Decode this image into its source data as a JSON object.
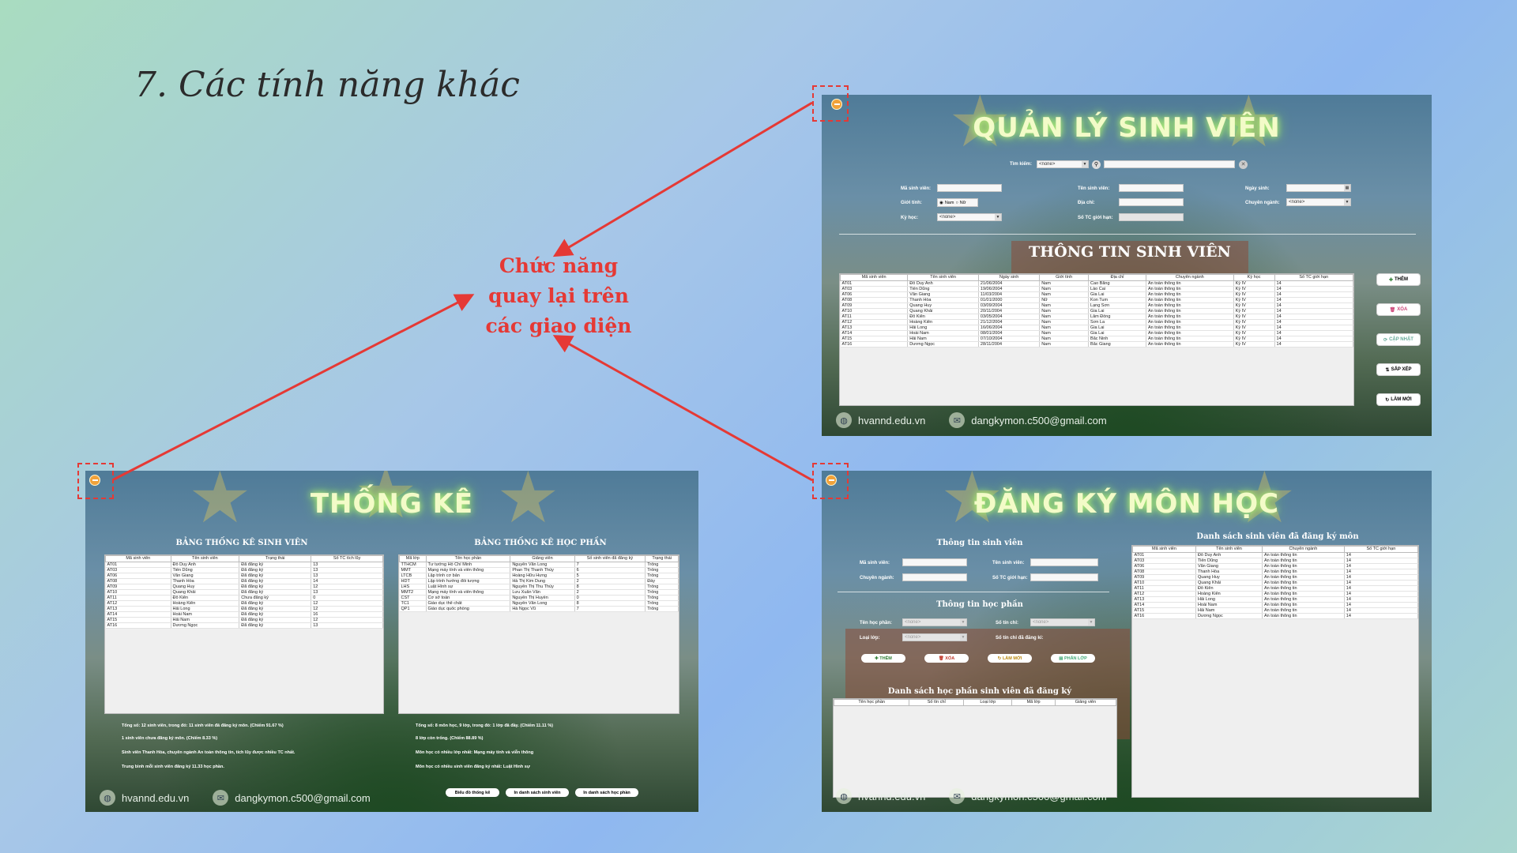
{
  "slide": {
    "title": "7. Các tính năng khác",
    "callout": [
      "Chức năng",
      "quay lại trên",
      "các giao diện"
    ]
  },
  "colors": {
    "callout_red": "#e53935",
    "title_glow": "#b9f57a"
  },
  "footer": {
    "site": "hvannd.edu.vn",
    "email": "dangkymon.c500@gmail.com"
  },
  "icons": {
    "back": "back-icon",
    "globe": "globe-icon",
    "mail": "mail-icon"
  },
  "qlsv": {
    "title": "QUẢN LÝ SINH VIÊN",
    "search_label": "Tìm kiếm:",
    "search_select": "<none>",
    "labels": {
      "ma_sv": "Mã sinh viên:",
      "ten_sv": "Tên sinh viên:",
      "ngay_sinh": "Ngày sinh:",
      "gioi_tinh": "Giới tính:",
      "dia_chi": "Địa chỉ:",
      "chuyen_nganh": "Chuyên ngành:",
      "ky_hoc": "Kỳ học:",
      "so_tc": "Số TC giới hạn:"
    },
    "gender": {
      "male": "Nam",
      "female": "Nữ"
    },
    "chuyen_nganh_value": "<none>",
    "ky_hoc_value": "<none>",
    "section": "THÔNG TIN SINH VIÊN",
    "columns": [
      "Mã sinh viên",
      "Tên sinh viên",
      "Ngày sinh",
      "Giới tính",
      "Địa chỉ",
      "Chuyên ngành",
      "Kỳ học",
      "Số TC giới hạn"
    ],
    "rows": [
      [
        "AT01",
        "Đỗ Duy Anh",
        "21/06/2004",
        "Nam",
        "Cao Bằng",
        "An toàn thông tin",
        "Kỳ IV",
        "14"
      ],
      [
        "AT03",
        "Tiến Dũng",
        "19/06/2004",
        "Nam",
        "Lào Cai",
        "An toàn thông tin",
        "Kỳ IV",
        "14"
      ],
      [
        "AT06",
        "Văn Giang",
        "11/03/2004",
        "Nam",
        "Gia Lai",
        "An toàn thông tin",
        "Kỳ IV",
        "14"
      ],
      [
        "AT08",
        "Thanh Hòa",
        "01/01/2000",
        "Nữ",
        "Kon Tum",
        "An toàn thông tin",
        "Kỳ IV",
        "14"
      ],
      [
        "AT09",
        "Quang Huy",
        "03/09/2004",
        "Nam",
        "Lạng Sơn",
        "An toàn thông tin",
        "Kỳ IV",
        "14"
      ],
      [
        "AT10",
        "Quang Khải",
        "20/11/2004",
        "Nam",
        "Gia Lai",
        "An toàn thông tin",
        "Kỳ IV",
        "14"
      ],
      [
        "AT11",
        "Đỗ Kiên",
        "03/05/2004",
        "Nam",
        "Lâm Đồng",
        "An toàn thông tin",
        "Kỳ IV",
        "14"
      ],
      [
        "AT12",
        "Hoàng Kiên",
        "21/12/2004",
        "Nam",
        "Sơn La",
        "An toàn thông tin",
        "Kỳ IV",
        "14"
      ],
      [
        "AT13",
        "Hải Long",
        "16/06/2004",
        "Nam",
        "Gia Lai",
        "An toàn thông tin",
        "Kỳ IV",
        "14"
      ],
      [
        "AT14",
        "Hoài Nam",
        "08/01/2004",
        "Nam",
        "Gia Lai",
        "An toàn thông tin",
        "Kỳ IV",
        "14"
      ],
      [
        "AT15",
        "Hải Nam",
        "07/10/2004",
        "Nam",
        "Bắc Ninh",
        "An toàn thông tin",
        "Kỳ IV",
        "14"
      ],
      [
        "AT16",
        "Dương Ngọc",
        "28/11/2004",
        "Nam",
        "Bắc Giang",
        "An toàn thông tin",
        "Kỳ IV",
        "14"
      ]
    ],
    "buttons": {
      "them": "THÊM",
      "xoa": "XÓA",
      "cap_nhat": "CẬP NHẬT",
      "sap_xep": "SẮP XẾP",
      "lam_moi": "LÀM MỚI"
    }
  },
  "thongke": {
    "title": "THỐNG KÊ",
    "sv_header": "BẢNG THỐNG KÊ SINH VIÊN",
    "hp_header": "BẢNG THỐNG KÊ HỌC PHẦN",
    "sv_columns": [
      "Mã sinh viên",
      "Tên sinh viên",
      "Trạng thái",
      "Số TC tích lũy"
    ],
    "sv_rows": [
      [
        "AT01",
        "Đỗ Duy Anh",
        "Đã đăng ký",
        "13"
      ],
      [
        "AT03",
        "Tiến Dũng",
        "Đã đăng ký",
        "13"
      ],
      [
        "AT06",
        "Văn Giang",
        "Đã đăng ký",
        "13"
      ],
      [
        "AT08",
        "Thanh Hòa",
        "Đã đăng ký",
        "14"
      ],
      [
        "AT09",
        "Quang Huy",
        "Đã đăng ký",
        "12"
      ],
      [
        "AT10",
        "Quang Khải",
        "Đã đăng ký",
        "13"
      ],
      [
        "AT11",
        "Đỗ Kiên",
        "Chưa đăng ký",
        "0"
      ],
      [
        "AT12",
        "Hoàng Kiên",
        "Đã đăng ký",
        "12"
      ],
      [
        "AT13",
        "Hải Long",
        "Đã đăng ký",
        "12"
      ],
      [
        "AT14",
        "Hoài Nam",
        "Đã đăng ký",
        "16"
      ],
      [
        "AT15",
        "Hải Nam",
        "Đã đăng ký",
        "12"
      ],
      [
        "AT16",
        "Dương Ngọc",
        "Đã đăng ký",
        "13"
      ]
    ],
    "hp_columns": [
      "Mã lớp",
      "Tên học phần",
      "Giảng viên",
      "Số sinh viên đã đăng ký",
      "Trạng thái"
    ],
    "hp_rows": [
      [
        "TTHCM",
        "Tư tưởng Hồ Chí Minh",
        "Nguyễn Văn Long",
        "7",
        "Trống"
      ],
      [
        "MMT",
        "Mạng máy tính và viễn thông",
        "Phan Thị Thanh Thủy",
        "6",
        "Trống"
      ],
      [
        "LTCB",
        "Lập trình cơ bản",
        "Hoàng Hữu Hưng",
        "5",
        "Trống"
      ],
      [
        "HDT",
        "Lập trình hướng đối tượng",
        "Hà Thị Kim Dung",
        "2",
        "Đầy"
      ],
      [
        "LHS",
        "Luật Hình sự",
        "Nguyễn Thị Thu Thủy",
        "8",
        "Trống"
      ],
      [
        "MMT2",
        "Mạng máy tính và viễn thông",
        "Lưu Xuân Văn",
        "2",
        "Trống"
      ],
      [
        "CST",
        "Cơ sở toán",
        "Nguyễn Thị Huyền",
        "0",
        "Trống"
      ],
      [
        "TC1",
        "Giáo dục thể chất",
        "Nguyễn Văn Long",
        "8",
        "Trống"
      ],
      [
        "QP1",
        "Giáo dục quốc phòng",
        "Hà Ngọc Vũ",
        "7",
        "Trống"
      ]
    ],
    "stats_left": [
      "Tổng số: 12 sinh viên, trong đó:          11 sinh viên đã đăng ký môn. (Chiếm 91.67 %)",
      "                                                                  1 sinh viên chưa đăng ký môn. (Chiếm 8.33 %)",
      "Sinh viên Thanh Hòa, chuyên ngành An toàn thông tin, tích lũy được nhiều TC nhất.",
      "Trung bình mỗi sinh viên đăng ký 11.33 học phần."
    ],
    "stats_right": [
      "Tổng số: 8 môn học, 9 lớp, trong đó:          1 lớp đã đầy. (Chiếm 11.11 %)",
      "                                                                   8 lớp còn trống. (Chiếm 88.89 %)",
      "Môn học có nhiều lớp nhất: Mạng máy tính và viễn thông",
      "Môn học có nhiều sinh viên đăng ký nhất: Luật Hình sự"
    ],
    "buttons": {
      "chart": "Biểu đồ thống kê",
      "print_sv": "In danh sách sinh viên",
      "print_hp": "In danh sách học phần"
    }
  },
  "dkmh": {
    "title": "ĐĂNG KÝ MÔN HỌC",
    "sv_section": "Thông tin sinh viên",
    "hp_section": "Thông tin học phần",
    "list_header": "Danh sách sinh viên đã đăng ký môn",
    "reg_header": "Danh sách học phần sinh viên đã đăng ký",
    "labels": {
      "ma_sv": "Mã sinh viên:",
      "ten_sv": "Tên sinh viên:",
      "chuyen_nganh": "Chuyên ngành:",
      "so_tc": "Số TC giới hạn:",
      "ten_hp": "Tên học phần:",
      "so_tin_chi": "Số tín chỉ:",
      "loai_lop": "Loại lớp:",
      "so_tc_da_dk": "Số tín chỉ đã đăng kí:"
    },
    "placeholders": {
      "ten_hp": "<none>",
      "so_tin_chi": "<none>",
      "loai_lop": "<none>"
    },
    "buttons": {
      "them": "THÊM",
      "xoa": "XÓA",
      "lam_moi": "LÀM MỚI",
      "phan_lop": "PHÂN LỚP"
    },
    "reg_columns": [
      "Tên học phần",
      "Số tín chỉ",
      "Loại lớp",
      "Mã lớp",
      "Giảng viên"
    ],
    "list_columns": [
      "Mã sinh viên",
      "Tên sinh viên",
      "Chuyên ngành",
      "Số TC giới hạn"
    ],
    "list_rows": [
      [
        "AT01",
        "Đỗ Duy Anh",
        "An toàn thông tin",
        "14"
      ],
      [
        "AT03",
        "Tiến Dũng",
        "An toàn thông tin",
        "14"
      ],
      [
        "AT06",
        "Văn Giang",
        "An toàn thông tin",
        "14"
      ],
      [
        "AT08",
        "Thanh Hòa",
        "An toàn thông tin",
        "14"
      ],
      [
        "AT09",
        "Quang Huy",
        "An toàn thông tin",
        "14"
      ],
      [
        "AT10",
        "Quang Khải",
        "An toàn thông tin",
        "14"
      ],
      [
        "AT11",
        "Đỗ Kiên",
        "An toàn thông tin",
        "14"
      ],
      [
        "AT12",
        "Hoàng Kiên",
        "An toàn thông tin",
        "14"
      ],
      [
        "AT13",
        "Hải Long",
        "An toàn thông tin",
        "14"
      ],
      [
        "AT14",
        "Hoài Nam",
        "An toàn thông tin",
        "14"
      ],
      [
        "AT15",
        "Hải Nam",
        "An toàn thông tin",
        "14"
      ],
      [
        "AT16",
        "Dương Ngọc",
        "An toàn thông tin",
        "14"
      ]
    ]
  }
}
